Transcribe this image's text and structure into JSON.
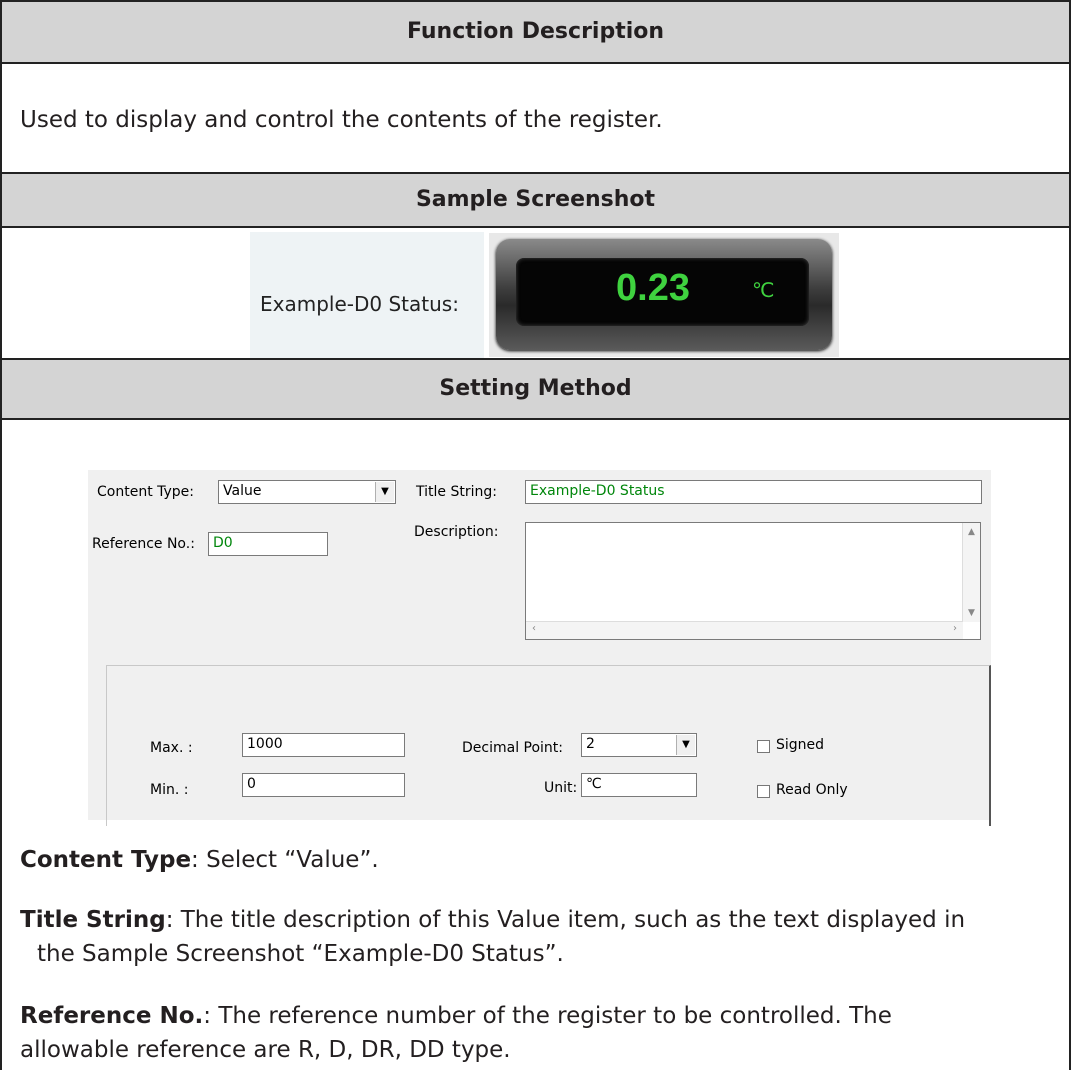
{
  "sections": {
    "function_description": "Function Description",
    "sample_screenshot": "Sample Screenshot",
    "setting_method": "Setting Method"
  },
  "function_text": "Used to display and control the contents of the register.",
  "sample": {
    "label": "Example-D0 Status:",
    "display_value": "0.23",
    "display_unit": "℃"
  },
  "form": {
    "content_type_label": "Content Type:",
    "content_type_value": "Value",
    "title_string_label": "Title String:",
    "title_string_value": "Example-D0 Status",
    "reference_label": "Reference No.:",
    "reference_value": "D0",
    "description_label": "Description:",
    "description_value": "",
    "max_label": "Max. :",
    "max_value": "1000",
    "min_label": "Min. :",
    "min_value": "0",
    "decimal_label": "Decimal Point:",
    "decimal_value": "2",
    "unit_label": "Unit:",
    "unit_value": "℃",
    "signed_label": "Signed",
    "signed_checked": false,
    "readonly_label": "Read Only",
    "readonly_checked": false
  },
  "descriptions": [
    {
      "term": "Content Type",
      "text": ": Select “Value”."
    },
    {
      "term": "Title String",
      "text": ": The title description of this Value item, such as the text displayed in",
      "cont": "the Sample Screenshot “Example-D0 Status”."
    },
    {
      "term": "Reference No.",
      "text": ": The reference number of the register to be controlled. The",
      "cont": "allowable reference are R, D, DR, DD type."
    }
  ]
}
